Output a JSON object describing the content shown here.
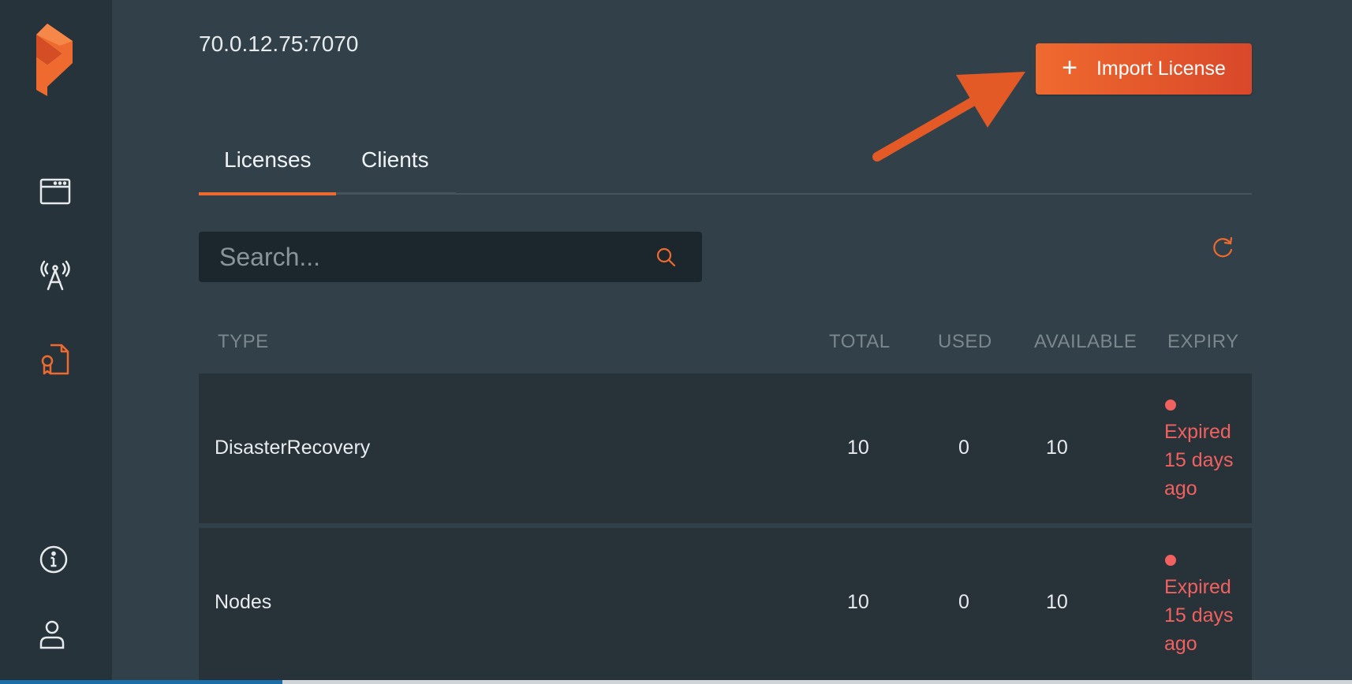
{
  "header": {
    "host": "70.0.12.75:7070",
    "import_label": "Import License",
    "import_icon": "plus-icon"
  },
  "sidebar": {
    "items": [
      {
        "name": "logo",
        "icon": "portworx-logo"
      },
      {
        "name": "clusters",
        "icon": "window-icon"
      },
      {
        "name": "broadcast",
        "icon": "antenna-icon"
      },
      {
        "name": "licenses",
        "icon": "certificate-icon",
        "active": true
      },
      {
        "name": "info",
        "icon": "info-icon"
      },
      {
        "name": "user",
        "icon": "user-icon"
      }
    ]
  },
  "tabs": [
    {
      "label": "Licenses",
      "active": true
    },
    {
      "label": "Clients",
      "active": false
    }
  ],
  "search": {
    "placeholder": "Search..."
  },
  "table": {
    "columns": [
      "TYPE",
      "TOTAL",
      "USED",
      "AVAILABLE",
      "EXPIRY"
    ],
    "rows": [
      {
        "type": "DisasterRecovery",
        "total": "10",
        "used": "0",
        "available": "10",
        "expiry_lines": [
          "Expired",
          "15 days",
          "ago"
        ]
      },
      {
        "type": "Nodes",
        "total": "10",
        "used": "0",
        "available": "10",
        "expiry_lines": [
          "Expired",
          "15 days",
          "ago"
        ]
      }
    ]
  },
  "colors": {
    "accent": "#ef6a2f",
    "expired": "#f0615f",
    "background": "#324049",
    "sidebar": "#26333a"
  }
}
